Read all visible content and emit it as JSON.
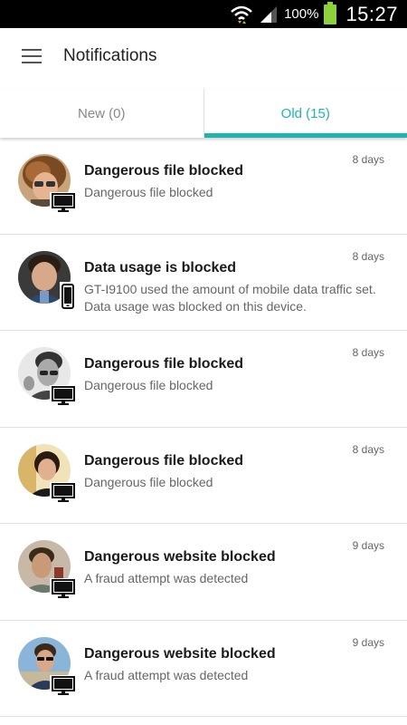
{
  "status_bar": {
    "battery_percent": "100%",
    "time": "15:27",
    "icons": [
      "wifi-icon",
      "signal-icon",
      "battery-icon"
    ]
  },
  "app_bar": {
    "title": "Notifications",
    "menu_icon": "hamburger-menu-icon"
  },
  "tabs": [
    {
      "label": "New (0)",
      "selected": false
    },
    {
      "label": "Old (15)",
      "selected": true
    }
  ],
  "colors": {
    "accent": "#1fb5ad",
    "status_bar_bg": "#000000",
    "battery": "#8fd13a"
  },
  "notifications": [
    {
      "title": "Dangerous file blocked",
      "description": "Dangerous file blocked",
      "time": "8 days",
      "device": "monitor-icon"
    },
    {
      "title": "Data usage is blocked",
      "description": "GT-I9100 used the amount of mobile data traffic set. Data usage was blocked on this device.",
      "time": "8 days",
      "device": "phone-icon"
    },
    {
      "title": "Dangerous file blocked",
      "description": "Dangerous file blocked",
      "time": "8 days",
      "device": "monitor-icon"
    },
    {
      "title": "Dangerous file blocked",
      "description": "Dangerous file blocked",
      "time": "8 days",
      "device": "monitor-icon"
    },
    {
      "title": "Dangerous website blocked",
      "description": "A fraud attempt was detected",
      "time": "9 days",
      "device": "monitor-icon"
    },
    {
      "title": "Dangerous website blocked",
      "description": "A fraud attempt was detected",
      "time": "9 days",
      "device": "monitor-icon"
    }
  ]
}
